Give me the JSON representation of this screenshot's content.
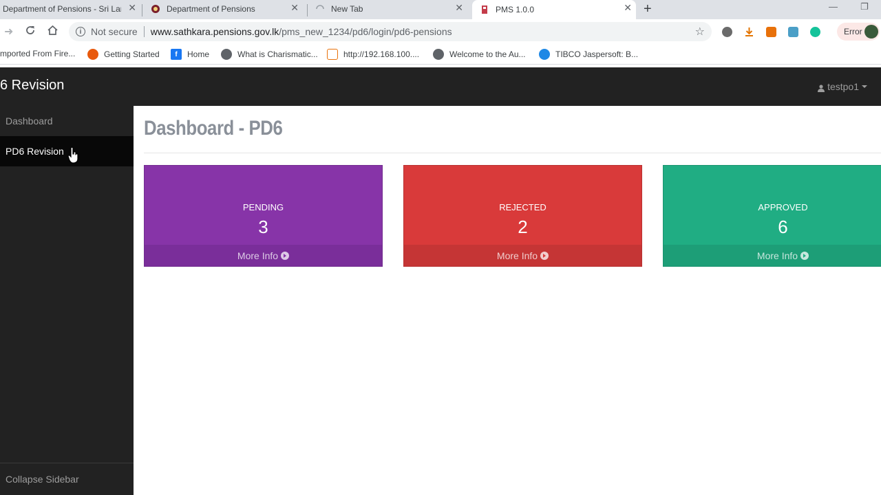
{
  "browser": {
    "tabs": [
      {
        "title": "Department of Pensions - Sri Lan",
        "active": false
      },
      {
        "title": "Department of Pensions",
        "active": false
      },
      {
        "title": "New Tab",
        "active": false
      },
      {
        "title": "PMS 1.0.0",
        "active": true
      }
    ],
    "new_tab_symbol": "+",
    "close_symbol": "✕",
    "security_label": "Not secure",
    "url_host": "www.sathkara.pensions.gov.lk",
    "url_path": "/pms_new_1234/pd6/login/pd6-pensions",
    "profile_status": "Error",
    "bookmarks": [
      {
        "label": "mported From Fire..."
      },
      {
        "label": "Getting Started"
      },
      {
        "label": "Home"
      },
      {
        "label": "What is Charismatic..."
      },
      {
        "label": "http://192.168.100...."
      },
      {
        "label": "Welcome to the Au..."
      },
      {
        "label": "TIBCO Jaspersoft: B..."
      }
    ]
  },
  "app": {
    "brand": "6 Revision",
    "user": "testpo1",
    "sidebar": {
      "items": [
        {
          "label": "Dashboard",
          "active": false
        },
        {
          "label": "PD6 Revision",
          "active": true
        }
      ],
      "collapse_label": "Collapse Sidebar"
    },
    "main": {
      "title": "Dashboard - PD6",
      "cards": [
        {
          "label": "PENDING",
          "count": "3",
          "link": "More Info",
          "color": "#8734a8",
          "footer_color": "#7a2e9a"
        },
        {
          "label": "REJECTED",
          "count": "2",
          "link": "More Info",
          "color": "#d93a3a",
          "footer_color": "#c53535"
        },
        {
          "label": "APPROVED",
          "count": "6",
          "link": "More Info",
          "color": "#20ad83",
          "footer_color": "#1d9e77"
        }
      ]
    }
  }
}
